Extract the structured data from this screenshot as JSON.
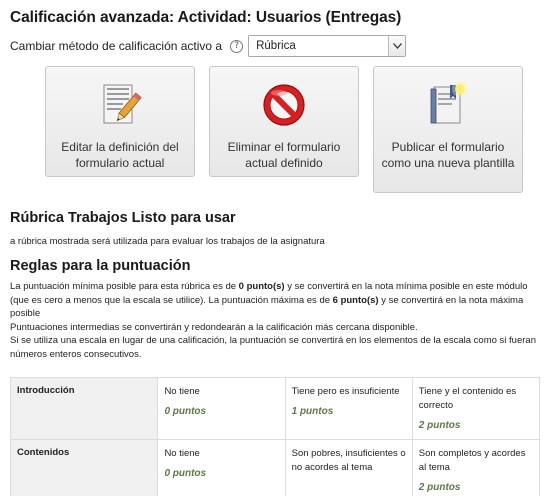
{
  "page": {
    "title": "Calificación avanzada: Actividad: Usuarios (Entregas)"
  },
  "method": {
    "label": "Cambiar método de calificación activo a",
    "help": "?",
    "selected": "Rúbrica",
    "arrow": "⌄"
  },
  "actions": {
    "edit": {
      "label": "Editar la definición del formulario actual",
      "icon": "edit-document-pencil-icon"
    },
    "delete": {
      "label": "Eliminar el formulario actual definido",
      "icon": "prohibited-icon"
    },
    "publish": {
      "label": "Publicar el formulario como una nueva plantilla",
      "icon": "publish-book-icon"
    }
  },
  "rubric_status": {
    "title": "Rúbrica Trabajos Listo para usar",
    "note": "a rúbrica mostrada será utilizada para evaluar los trabajos de la asignatura"
  },
  "rules": {
    "title": "Reglas para la puntuación",
    "p1_a": "La puntuación mínima posible para esta rúbrica es de ",
    "p1_min": "0 punto(s)",
    "p1_b": " y se convertirá en la nota mínima posible en este módulo (que es cero a menos que la escala se utilice). La puntuación máxima es de ",
    "p1_max": "6 punto(s)",
    "p1_c": " y se convertirá en la nota máxima posible",
    "p2": "Puntuaciones intermedias se convertirán y redondearán a la calificación más cercana disponible.",
    "p3": "Si se utiliza una escala en lugar de una calificación, la puntuación se convertirá en los elementos de la escala como si fueran números enteros consecutivos."
  },
  "rubric": {
    "rows": [
      {
        "criterion": "Introducción",
        "levels": [
          {
            "desc": "No tiene",
            "points": "0 puntos"
          },
          {
            "desc": "Tiene pero es insuficiente",
            "points": "1 puntos"
          },
          {
            "desc": "Tiene y el contenido es correcto",
            "points": "2 puntos"
          }
        ]
      },
      {
        "criterion": "Contenidos",
        "levels": [
          {
            "desc": "No tiene",
            "points": "0 puntos"
          },
          {
            "desc": "Son pobres, insuficientes o no acordes al tema",
            "points": ""
          },
          {
            "desc": "Son completos y acordes al tema",
            "points": "2 puntos"
          }
        ]
      }
    ]
  }
}
